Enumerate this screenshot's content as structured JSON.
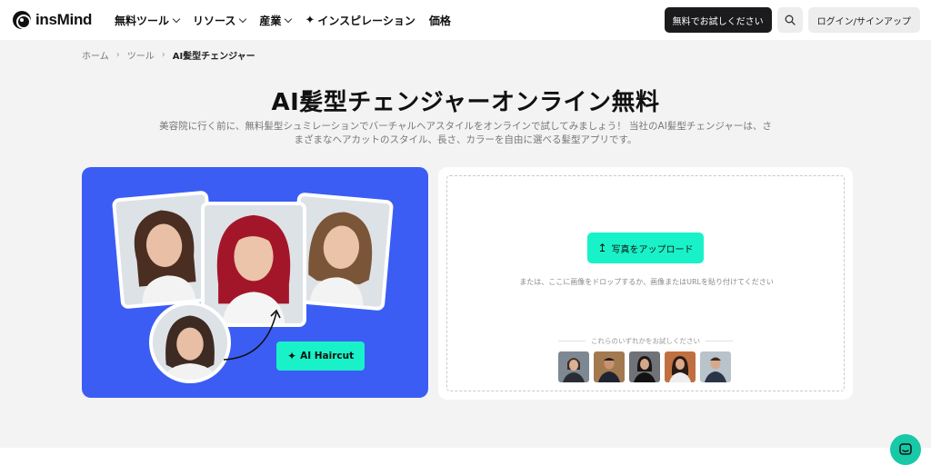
{
  "header": {
    "logo_text": "insMind",
    "nav": [
      {
        "label": "無料ツール",
        "dropdown": true
      },
      {
        "label": "リソース",
        "dropdown": true
      },
      {
        "label": "産業",
        "dropdown": true
      },
      {
        "label": "インスピレーション",
        "dropdown": false
      },
      {
        "label": "価格",
        "dropdown": false
      }
    ],
    "try_button": "無料でお試しください",
    "login_button": "ログイン/サインアップ"
  },
  "breadcrumb": {
    "home": "ホーム",
    "tools": "ツール",
    "current": "AI髪型チェンジャー"
  },
  "page": {
    "title": "AI髪型チェンジャーオンライン無料",
    "subtitle": "美容院に行く前に、無料髪型シュミレーションでバーチャルヘアスタイルをオンラインで試してみましょう！ 当社のAI髪型チェンジャーは、さまざまなヘアカットのスタイル、長さ、カラーを自由に選べる髪型アプリです。"
  },
  "showcase": {
    "tag_label": "AI Haircut"
  },
  "upload": {
    "button_label": "写真をアップロード",
    "drop_hint": "または、ここに画像をドロップするか、画像またはURLを貼り付けてください",
    "try_label": "これらのいずれかをお試しください",
    "sample_count": 5
  },
  "colors": {
    "accent": "#19f2c8",
    "showcase_bg": "#3b5df3",
    "chat": "#17c9a6"
  }
}
